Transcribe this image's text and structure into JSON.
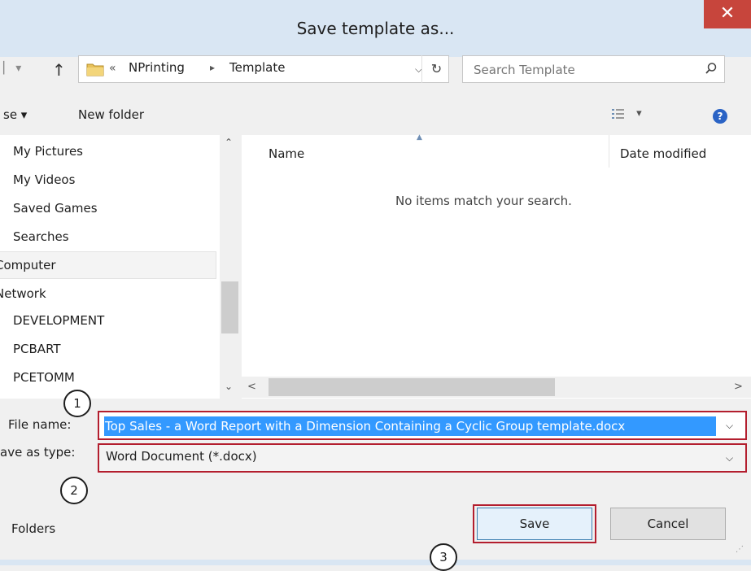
{
  "window": {
    "title": "Save template as...",
    "close_glyph": "✕"
  },
  "address_bar": {
    "breadcrumb_prefix": "«",
    "breadcrumbs": [
      "NPrinting",
      "Template"
    ],
    "crumb_separator": "▸",
    "search_placeholder": "Search Template"
  },
  "toolbar": {
    "organize_label": "se ▾",
    "new_folder_label": "New folder",
    "views_label": "▾",
    "help_glyph": "?"
  },
  "nav_pane": {
    "items": [
      "My Pictures",
      "My Videos",
      "Saved Games",
      "Searches",
      "Computer",
      "Network",
      "DEVELOPMENT",
      "PCBART",
      "PCETOMM"
    ]
  },
  "file_list": {
    "columns": [
      "Name",
      "Date modified"
    ],
    "empty_message": "No items match your search."
  },
  "form": {
    "file_name_label": "File name:",
    "file_name_value": "Top Sales - a Word Report with a Dimension Containing a Cyclic Group template.docx",
    "save_as_type_label": "ave as type:",
    "save_as_type_value": "Word Document (*.docx)"
  },
  "footer": {
    "folders_label": "Folders",
    "save_label": "Save",
    "cancel_label": "Cancel"
  },
  "callouts": [
    "1",
    "2",
    "3"
  ],
  "colors": {
    "title_bar": "#d9e6f3",
    "close_button": "#c7453c",
    "highlight_outline": "#b31e2e",
    "selection": "#3399ff"
  }
}
